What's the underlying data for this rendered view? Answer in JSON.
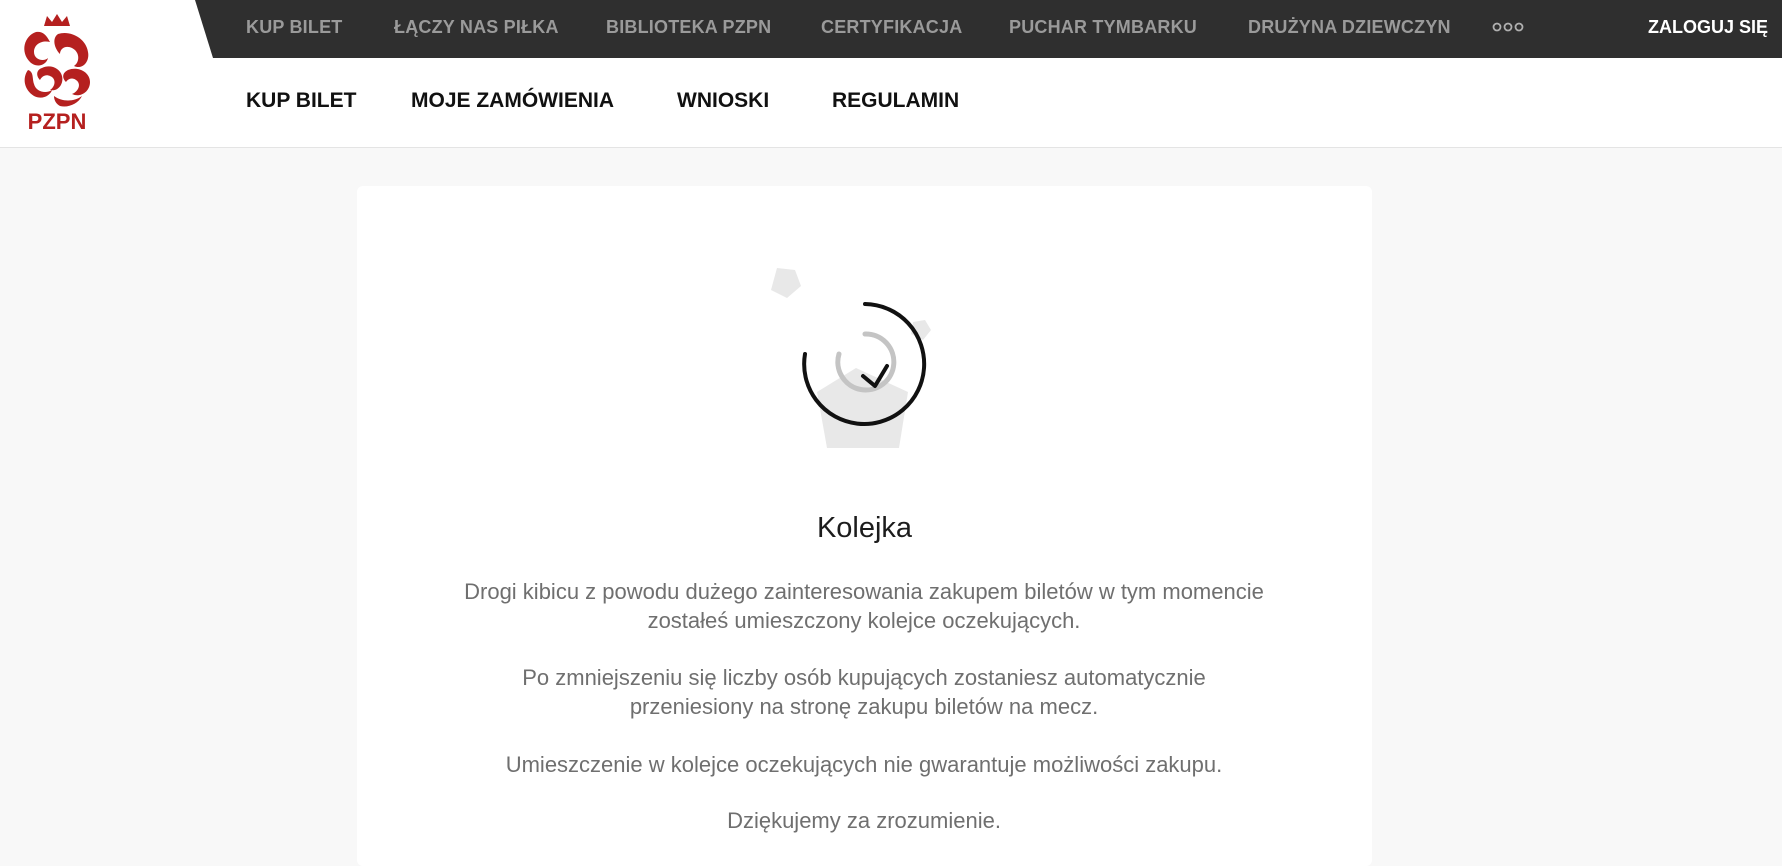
{
  "header": {
    "logo_text": "PZPN",
    "top_nav": [
      {
        "label": "KUP BILET"
      },
      {
        "label": "ŁĄCZY NAS PIŁKA"
      },
      {
        "label": "BIBLIOTEKA PZPN"
      },
      {
        "label": "CERTYFIKACJA"
      },
      {
        "label": "PUCHAR TYMBARKU"
      },
      {
        "label": "DRUŻYNA DZIEWCZYN"
      }
    ],
    "more_icon": "more-dots-icon",
    "login_label": "ZALOGUJ SIĘ",
    "main_nav": [
      {
        "label": "KUP BILET"
      },
      {
        "label": "MOJE ZAMÓWIENIA"
      },
      {
        "label": "WNIOSKI"
      },
      {
        "label": "REGULAMIN"
      }
    ]
  },
  "queue": {
    "icon": "queue-refresh-icon",
    "title": "Kolejka",
    "paragraphs": [
      "Drogi kibicu z powodu dużego zainteresowania zakupem biletów w tym momencie zostałeś umieszczony kolejce oczekujących.",
      "Po zmniejszeniu się liczby osób kupujących zostaniesz automatycznie przeniesiony na stronę zakupu biletów na mecz.",
      "Umieszczenie w kolejce oczekujących nie gwarantuje możliwości zakupu.",
      "Dziękujemy za zrozumienie."
    ]
  },
  "colors": {
    "brand_red": "#b5201f",
    "topbar_bg": "#2f2f2f",
    "page_bg": "#f8f8f8"
  }
}
